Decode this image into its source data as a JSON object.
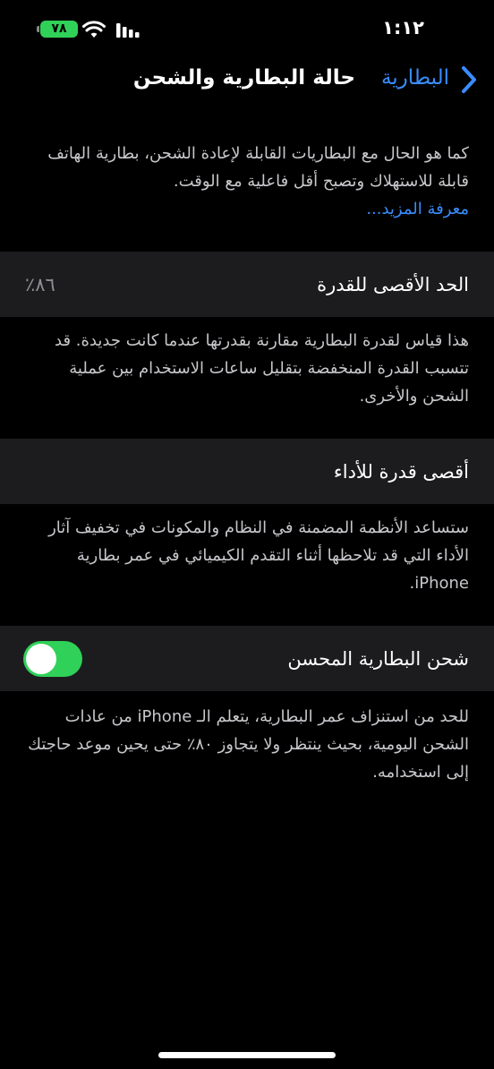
{
  "status_bar": {
    "time": "١:١٢",
    "battery_level": "٧٨",
    "battery_color": "#30d158"
  },
  "nav": {
    "back_label": "البطارية",
    "title": "حالة البطارية والشحن",
    "accent_color": "#3a8dff"
  },
  "intro": {
    "text": "كما هو الحال مع البطاريات القابلة لإعادة الشحن، بطارية الهاتف قابلة للاستهلاك وتصبح أقل فاعلية مع الوقت.",
    "link": "معرفة المزيد..."
  },
  "maximum_capacity": {
    "label": "الحد الأقصى للقدرة",
    "value": "٨٦٪",
    "footnote": "هذا قياس لقدرة البطارية مقارنة بقدرتها عندما كانت جديدة. قد تتسبب القدرة المنخفضة بتقليل ساعات الاستخدام بين عملية الشحن والأخرى."
  },
  "peak_performance": {
    "label": "أقصى قدرة للأداء",
    "footnote": "ستساعد الأنظمة المضمنة في النظام والمكونات في تخفيف آثار الأداء التي قد تلاحظها أثناء التقدم الكيميائي في عمر بطارية iPhone."
  },
  "optimized_charging": {
    "label": "شحن البطارية المحسن",
    "enabled": true,
    "toggle_color": "#30d158",
    "footnote": "للحد من استنزاف عمر البطارية، يتعلم الـ iPhone من عادات الشحن اليومية، بحيث ينتظر ولا يتجاوز ٨٠٪ حتى يحين موعد حاجتك إلى استخدامه."
  }
}
